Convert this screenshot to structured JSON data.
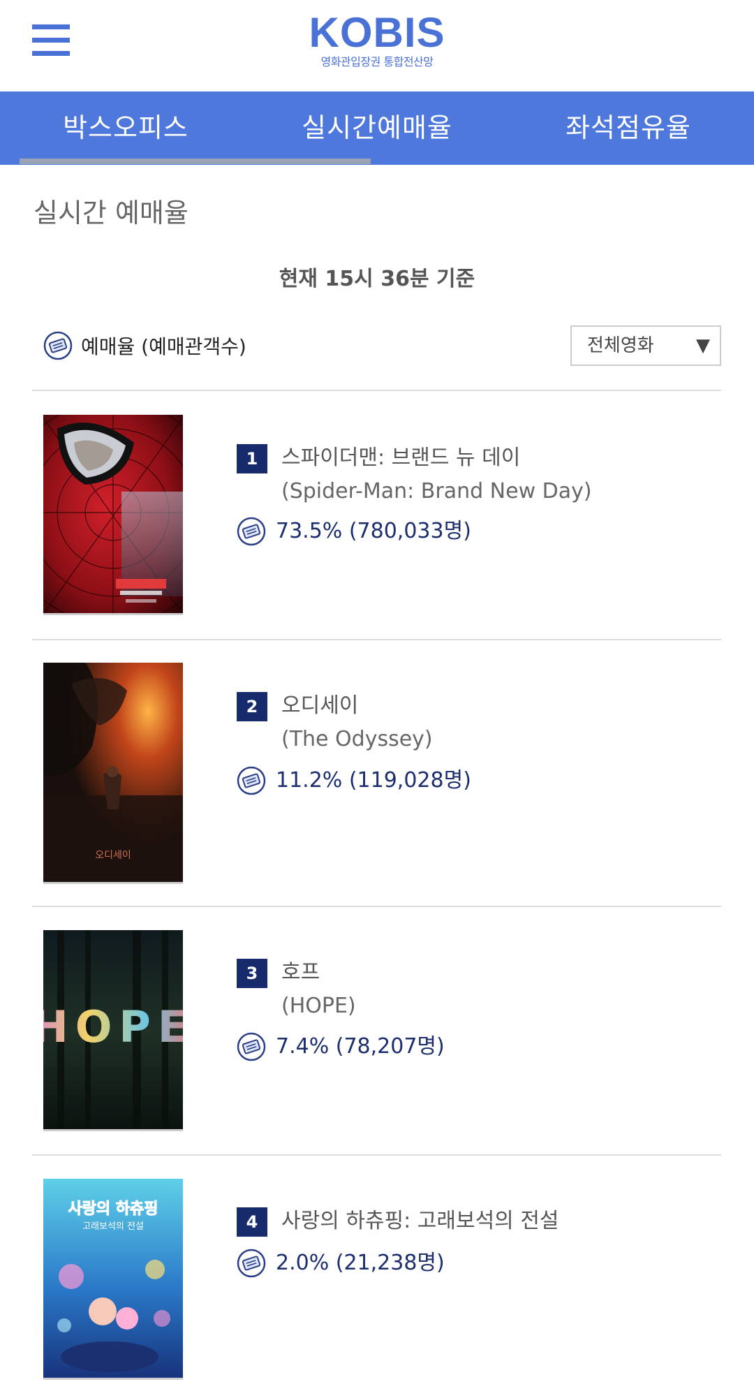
{
  "app": {
    "logo_title": "KOBIS",
    "logo_subtitle": "영화관입장권 통합전산망"
  },
  "tabs": [
    {
      "label": "박스오피스"
    },
    {
      "label": "실시간예매율"
    },
    {
      "label": "좌석점유율"
    }
  ],
  "page": {
    "title": "실시간 예매율",
    "timestamp": "현재  15시 36분   기준",
    "legend_label": "예매율 (예매관객수)",
    "filter_value": "전체영화",
    "filter_arrow": "▼"
  },
  "movies": [
    {
      "rank": "1",
      "title_ko": "스파이더맨: 브랜드 뉴 데이",
      "title_en": "(Spider-Man: Brand New Day)",
      "rate": "73.5% (780,033명)"
    },
    {
      "rank": "2",
      "title_ko": "오디세이",
      "title_en": "(The Odyssey)",
      "rate": "11.2% (119,028명)"
    },
    {
      "rank": "3",
      "title_ko": "호프",
      "title_en": "(HOPE)",
      "rate": "7.4% (78,207명)"
    },
    {
      "rank": "4",
      "title_ko": "사랑의 하츄핑: 고래보석의 전설",
      "title_en": "",
      "rate": "2.0% (21,238명)"
    }
  ],
  "posters": [
    {
      "text": "",
      "subtext": ""
    },
    {
      "text": "오디세이",
      "subtext": ""
    },
    {
      "text": "HOPE",
      "subtext": ""
    },
    {
      "text": "사랑의 하츄핑",
      "subtext": "고래보석의 전설"
    }
  ],
  "colors": {
    "brand": "#4a72d6",
    "tab_bar": "#4f78dc",
    "rank_badge": "#172a6b",
    "rate_text": "#1d2e6e"
  }
}
